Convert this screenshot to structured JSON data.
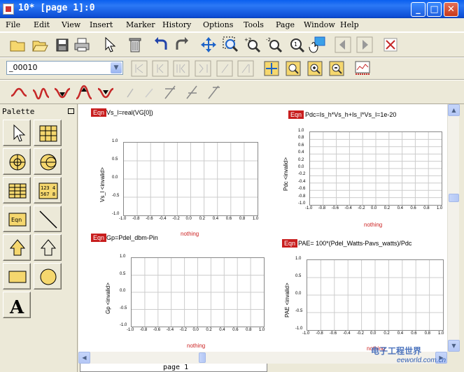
{
  "window": {
    "title": "10* [page 1]:0",
    "min_glyph": "_",
    "max_glyph": "□",
    "close_glyph": "✕"
  },
  "menu": [
    "File",
    "Edit",
    "View",
    "Insert",
    "Marker",
    "History",
    "Options",
    "Tools",
    "Page",
    "Window",
    "Help"
  ],
  "toolbar": {
    "layer_value": "_00010",
    "layer_arrow": "▼"
  },
  "palette": {
    "title": "Palette",
    "eqn_label": "Eqn",
    "table_text_top": "123 4",
    "table_text_bottom": "567 8",
    "text_tool_glyph": "A"
  },
  "plots": [
    {
      "eqn_badge": "Eqn",
      "equation": "Vs_l=real(VG[0])",
      "ylabel": "Vs_l <invalid>",
      "xlabel": "nothing",
      "x_ticks": [
        "-1.0",
        "-0.8",
        "-0.6",
        "-0.4",
        "-0.2",
        "0.0",
        "0.2",
        "0.4",
        "0.6",
        "0.8",
        "1.0"
      ],
      "y_ticks": [
        "1.0",
        "0.5",
        "0.0",
        "-0.5",
        "-1.0"
      ]
    },
    {
      "eqn_badge": "Eqn",
      "equation": "Pdc=Is_h*Vs_h+Is_l*Vs_l=1e-20",
      "ylabel": "Pdc <invalid>",
      "xlabel": "nothing",
      "x_ticks": [
        "-1.0",
        "-0.8",
        "-0.6",
        "-0.4",
        "-0.2",
        "0.0",
        "0.2",
        "0.4",
        "0.6",
        "0.8",
        "1.0"
      ],
      "y_ticks": [
        "1.0",
        "0.8",
        "0.6",
        "0.4",
        "0.2",
        "0.0",
        "-0.2",
        "-0.4",
        "-0.6",
        "-0.8",
        "-1.0"
      ]
    },
    {
      "eqn_badge": "Eqn",
      "equation": "Gp=Pdel_dbm-Pin",
      "ylabel": "Gp <invalid>",
      "xlabel": "nothing",
      "x_ticks": [
        "-1.0",
        "-0.8",
        "-0.6",
        "-0.4",
        "-0.2",
        "0.0",
        "0.2",
        "0.4",
        "0.6",
        "0.8",
        "1.0"
      ],
      "y_ticks": [
        "1.0",
        "0.5",
        "0.0",
        "-0.5",
        "-1.0"
      ]
    },
    {
      "eqn_badge": "Eqn",
      "equation": "PAE= 100*(Pdel_Watts-Pavs_watts)/Pdc",
      "ylabel": "PAE <invalid>",
      "xlabel": "nothing",
      "x_ticks": [
        "-1.0",
        "-0.8",
        "-0.6",
        "-0.4",
        "-0.2",
        "0.0",
        "0.2",
        "0.4",
        "0.6",
        "0.8",
        "1.0"
      ],
      "y_ticks": [
        "1.0",
        "0.5",
        "0.0",
        "-0.5",
        "-1.0"
      ]
    }
  ],
  "scroll": {
    "up": "▲",
    "down": "▼",
    "left": "◀",
    "right": "▶"
  },
  "page_tab": "page 1",
  "watermark": {
    "line1": "电子工程世界",
    "line2": "eeworld.com.cn"
  },
  "colors": {
    "title_bar": "#0A5FEF",
    "eqn_badge": "#C81E1E",
    "xlabel": "#CC2222",
    "grid": "#CCCCCC"
  },
  "icons": {
    "toolbar1": [
      "new-folder-icon",
      "open-folder-icon",
      "save-icon",
      "print-icon",
      "select-arrow-icon",
      "delete-icon",
      "undo-icon",
      "redo-icon",
      "move-icon",
      "zoom-area-icon",
      "zoom-in-icon",
      "zoom-out-icon",
      "zoom-fit-icon",
      "pan-icon",
      "back-icon",
      "forward-icon",
      "stop-icon"
    ],
    "toolbar2": [
      "first-icon",
      "prev-icon",
      "prev2-icon",
      "next2-icon",
      "next-icon",
      "last-icon",
      "zoom-box-icon",
      "zoom-view-icon",
      "zoom-plus-icon",
      "zoom-minus-icon",
      "export-icon"
    ],
    "toolbar3": [
      "marker-peak-icon",
      "marker-valley-icon",
      "marker-down-icon",
      "marker-up-icon",
      "marker-max-icon",
      "marker-line-icon",
      "marker-delta-icon",
      "marker-x-icon",
      "marker-y-icon",
      "marker-z-icon"
    ]
  }
}
